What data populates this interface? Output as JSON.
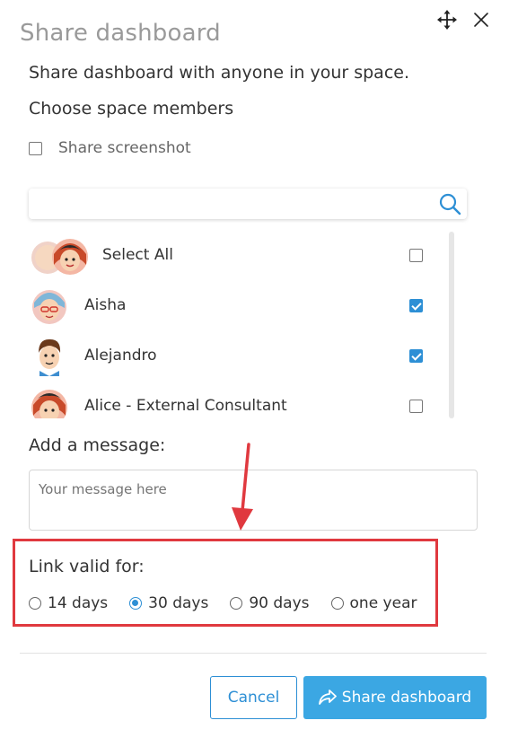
{
  "dialog": {
    "title": "Share dashboard",
    "subtitle": "Share dashboard with anyone in your space.",
    "choose_label": "Choose space members",
    "share_screenshot_label": "Share screenshot",
    "share_screenshot_checked": false
  },
  "search": {
    "value": "",
    "placeholder": ""
  },
  "members": [
    {
      "name": "Select All",
      "checked": false,
      "avatar": "group-avatar"
    },
    {
      "name": "Aisha",
      "checked": true,
      "avatar": "avatar-aisha"
    },
    {
      "name": "Alejandro",
      "checked": true,
      "avatar": "avatar-alejandro"
    },
    {
      "name": "Alice - External Consultant",
      "checked": false,
      "avatar": "avatar-alice"
    }
  ],
  "message": {
    "label": "Add a message:",
    "placeholder": "Your message here",
    "value": ""
  },
  "link_validity": {
    "label": "Link valid for:",
    "options": [
      "14 days",
      "30 days",
      "90 days",
      "one year"
    ],
    "selected": "30 days"
  },
  "buttons": {
    "cancel": "Cancel",
    "share": "Share dashboard"
  },
  "colors": {
    "accent": "#2d8fd5",
    "primary_button": "#3ba7e3",
    "highlight": "#e0393f"
  },
  "icons": {
    "move": "move-icon",
    "close": "close-icon",
    "search": "search-icon",
    "share": "share-arrow-icon"
  }
}
